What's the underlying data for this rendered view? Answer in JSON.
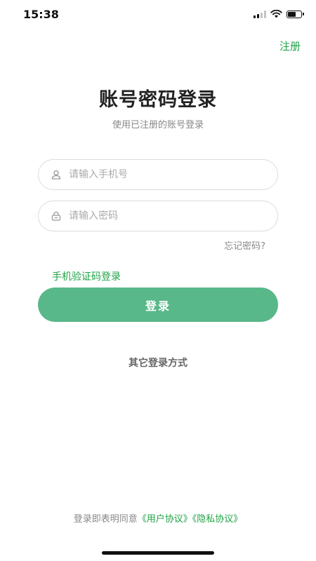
{
  "status_bar": {
    "time": "15:38",
    "signal_icon": "cellular-signal-icon",
    "wifi_icon": "wifi-icon",
    "battery_icon": "battery-icon",
    "battery_level": 0.6
  },
  "header": {
    "register_label": "注册"
  },
  "login": {
    "title": "账号密码登录",
    "subtitle": "使用已注册的账号登录",
    "phone_field": {
      "icon": "user-icon",
      "placeholder": "请输入手机号",
      "value": ""
    },
    "password_field": {
      "icon": "lock-icon",
      "placeholder": "请输入密码",
      "value": ""
    },
    "forgot_password_label": "忘记密码?",
    "sms_login_label": "手机验证码登录",
    "submit_label": "登录",
    "other_methods_label": "其它登录方式"
  },
  "agreement": {
    "prefix": "登录即表明同意",
    "user_agreement": "《用户协议》",
    "privacy_policy": "《隐私协议》"
  },
  "colors": {
    "accent_green": "#1ea345",
    "button_green": "#58b889"
  }
}
